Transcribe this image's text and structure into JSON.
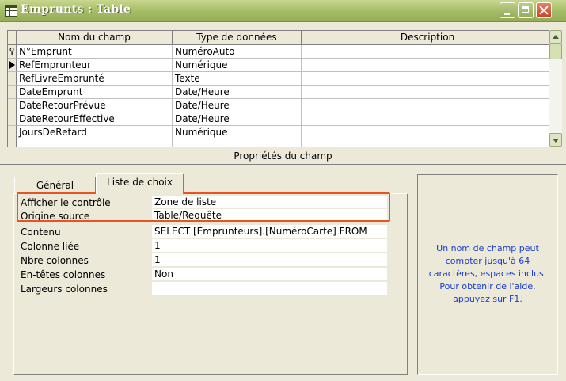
{
  "window": {
    "title": "Emprunts : Table",
    "icon": "table-icon"
  },
  "grid": {
    "headers": [
      "Nom du champ",
      "Type de données",
      "Description"
    ],
    "rows": [
      {
        "name": "N°Emprunt",
        "type": "NuméroAuto",
        "description": "",
        "selector": "key-icon"
      },
      {
        "name": "RefEmprunteur",
        "type": "Numérique",
        "description": "",
        "selector": "current-row-arrow-icon"
      },
      {
        "name": "RefLivreEmprunté",
        "type": "Texte",
        "description": "",
        "selector": ""
      },
      {
        "name": "DateEmprunt",
        "type": "Date/Heure",
        "description": "",
        "selector": ""
      },
      {
        "name": "DateRetourPrévue",
        "type": "Date/Heure",
        "description": "",
        "selector": ""
      },
      {
        "name": "DateRetourEffective",
        "type": "Date/Heure",
        "description": "",
        "selector": ""
      },
      {
        "name": "JoursDeRetard",
        "type": "Numérique",
        "description": "",
        "selector": ""
      }
    ]
  },
  "properties": {
    "caption": "Propriétés du champ",
    "tabs": [
      "Général",
      "Liste de choix"
    ],
    "active_tab": "Liste de choix",
    "rows": [
      {
        "label": "Afficher le contrôle",
        "value": "Zone de liste"
      },
      {
        "label": "Origine source",
        "value": "Table/Requête"
      },
      {
        "label": "Contenu",
        "value": "SELECT [Emprunteurs].[NuméroCarte] FROM"
      },
      {
        "label": "Colonne liée",
        "value": "1"
      },
      {
        "label": "Nbre colonnes",
        "value": "1"
      },
      {
        "label": "En-têtes colonnes",
        "value": "Non"
      },
      {
        "label": "Largeurs colonnes",
        "value": ""
      }
    ],
    "help": "Un nom de champ peut compter jusqu'à 64 caractères, espaces inclus. Pour obtenir de l'aide, appuyez sur F1."
  },
  "colors": {
    "highlight": "#e8541f",
    "help_text": "#1a3cc8",
    "titlebar": "#a9c06a"
  }
}
